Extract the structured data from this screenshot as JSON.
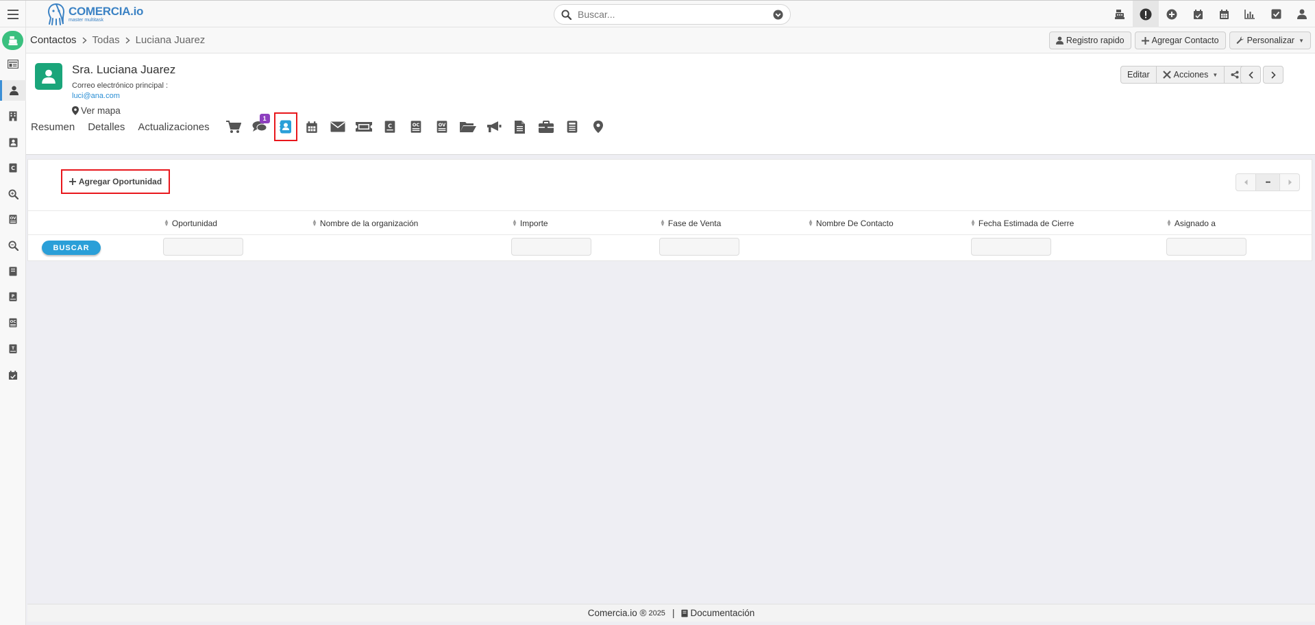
{
  "app": {
    "logo_main": "COMERCIA.io",
    "logo_sub": "master multitask"
  },
  "search": {
    "placeholder": "Buscar..."
  },
  "breadcrumb": {
    "items": [
      "Contactos",
      "Todas",
      "Luciana Juarez"
    ]
  },
  "crumb_actions": {
    "quick_record": "Registro rapido",
    "add_contact": "Agregar Contacto",
    "customize": "Personalizar"
  },
  "contact": {
    "name": "Sra. Luciana Juarez",
    "email_label": "Correo electrónico principal :",
    "email": "luci@ana.com",
    "map_label": "Ver mapa"
  },
  "header_actions": {
    "edit": "Editar",
    "actions": "Acciones"
  },
  "tabs": {
    "summary": "Resumen",
    "details": "Detalles",
    "updates": "Actualizaciones",
    "comments_badge": "1"
  },
  "panel": {
    "add_opportunity": "Agregar Oportunidad",
    "pager_more": "•••",
    "search_button": "BUSCAR",
    "columns": [
      "Oportunidad",
      "Nombre de la organización",
      "Importe",
      "Fase de Venta",
      "Nombre De Contacto",
      "Fecha Estimada de Cierre",
      "Asignado a"
    ]
  },
  "footer": {
    "brand": "Comercia.io ®",
    "year": "2025",
    "separator": "|",
    "docs": "Documentación"
  },
  "colors": {
    "accent": "#2a9fd8",
    "avatar": "#1aa57a",
    "highlight": "#e8161b",
    "badge": "#8d3fbf"
  }
}
